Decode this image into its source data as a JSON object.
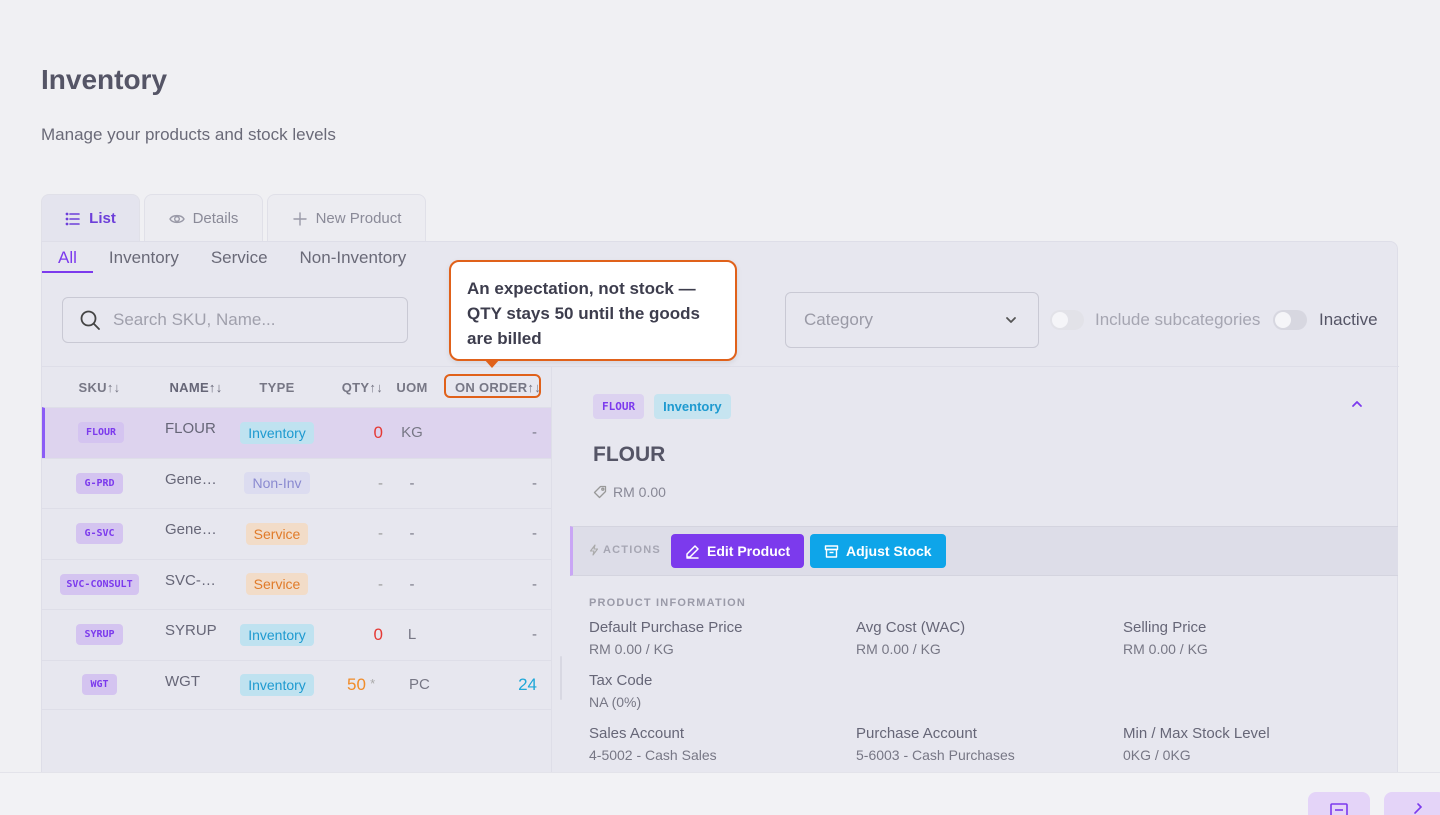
{
  "page": {
    "title": "Inventory",
    "subtitle": "Manage your products and stock levels"
  },
  "view_tabs": [
    {
      "label": "List",
      "icon": "list-icon",
      "active": true
    },
    {
      "label": "Details",
      "icon": "eye-icon",
      "active": false
    },
    {
      "label": "New Product",
      "icon": "plus-icon",
      "active": false
    }
  ],
  "type_filters": [
    {
      "label": "All",
      "active": true
    },
    {
      "label": "Inventory",
      "active": false
    },
    {
      "label": "Service",
      "active": false
    },
    {
      "label": "Non-Inventory",
      "active": false
    }
  ],
  "search": {
    "placeholder": "Search SKU, Name..."
  },
  "category": {
    "placeholder": "Category"
  },
  "toggles": {
    "include_subcategories": "Include subcategories",
    "inactive": "Inactive"
  },
  "table": {
    "headers": {
      "sku": "SKU↑↓",
      "name": "NAME↑↓",
      "type": "TYPE",
      "qty": "QTY↑↓",
      "uom": "UOM",
      "on_order": "ON ORDER↑↓"
    },
    "rows": [
      {
        "sku": "FLOUR",
        "name": "FLOUR",
        "type": "Inventory",
        "qty": "0",
        "uom": "KG",
        "on_order": "-"
      },
      {
        "sku": "G-PRD",
        "name": "Gene…",
        "type": "Non-Inv",
        "qty": "-",
        "uom": "-",
        "on_order": "-"
      },
      {
        "sku": "G-SVC",
        "name": "Gene…",
        "type": "Service",
        "qty": "-",
        "uom": "-",
        "on_order": "-"
      },
      {
        "sku": "SVC-CONSULT",
        "name": "SVC-…",
        "type": "Service",
        "qty": "-",
        "uom": "-",
        "on_order": "-"
      },
      {
        "sku": "SYRUP",
        "name": "SYRUP",
        "type": "Inventory",
        "qty": "0",
        "uom": "L",
        "on_order": "-"
      },
      {
        "sku": "WGT",
        "name": "WGT",
        "type": "Inventory",
        "qty": "50",
        "qty_marker": "*",
        "uom": "PC",
        "on_order": "24"
      }
    ]
  },
  "detail": {
    "sku": "FLOUR",
    "type": "Inventory",
    "name": "FLOUR",
    "price": "RM 0.00",
    "actions_label": "ACTIONS",
    "edit_button": "Edit Product",
    "adjust_button": "Adjust Stock",
    "info_heading": "PRODUCT INFORMATION",
    "info": {
      "default_purchase_price": {
        "label": "Default Purchase Price",
        "value": "RM 0.00 / KG"
      },
      "avg_cost": {
        "label": "Avg Cost (WAC)",
        "value": "RM 0.00 / KG"
      },
      "selling_price": {
        "label": "Selling Price",
        "value": "RM 0.00 / KG"
      },
      "tax_code": {
        "label": "Tax Code",
        "value": "NA (0%)"
      },
      "sales_account": {
        "label": "Sales Account",
        "value": "4-5002 - Cash Sales"
      },
      "purchase_account": {
        "label": "Purchase Account",
        "value": "5-6003 - Cash Purchases"
      },
      "min_max_stock": {
        "label": "Min / Max Stock Level",
        "value": "0KG / 0KG"
      }
    }
  },
  "callout": {
    "text": "An expectation, not stock — QTY stays 50 until the goods are billed"
  },
  "colors": {
    "accent": "#7c3aed",
    "info": "#0ea5e9",
    "callout_border": "#e0611a",
    "qty_zero": "#e53935",
    "qty_pending": "#f08c2a"
  }
}
